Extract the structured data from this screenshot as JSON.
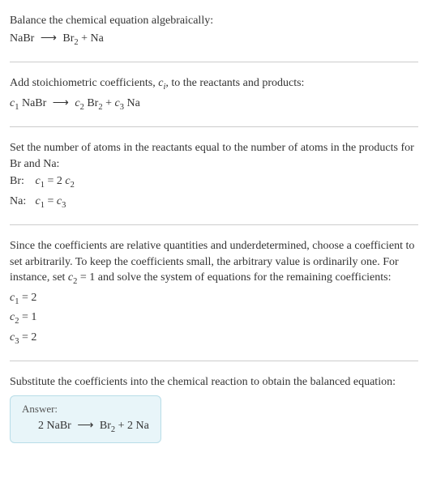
{
  "chart_data": {
    "type": "table",
    "title": "Balance the chemical equation algebraically",
    "equation_unbalanced": "NaBr -> Br2 + Na",
    "equation_with_coeffs": "c1 NaBr -> c2 Br2 + c3 Na",
    "atom_balance": [
      {
        "element": "Br",
        "equation": "c1 = 2 c2"
      },
      {
        "element": "Na",
        "equation": "c1 = c3"
      }
    ],
    "coefficient_solution": [
      {
        "name": "c1",
        "value": 2
      },
      {
        "name": "c2",
        "value": 1
      },
      {
        "name": "c3",
        "value": 2
      }
    ],
    "balanced_equation": "2 NaBr -> Br2 + 2 Na"
  },
  "s1": {
    "heading": "Balance the chemical equation algebraically:",
    "eq_lhs": "NaBr",
    "arrow": "⟶",
    "eq_rhs_a": "Br",
    "eq_rhs_a_sub": "2",
    "eq_rhs_plus": " + Na"
  },
  "s2": {
    "heading_a": "Add stoichiometric coefficients, ",
    "heading_ci": "c",
    "heading_ci_sub": "i",
    "heading_b": ", to the reactants and products:",
    "c1": "c",
    "c1_sub": "1",
    "c1_sp": " NaBr ",
    "arrow": "⟶",
    "c2_sp": " ",
    "c2": "c",
    "c2_sub": "2",
    "c2_br": " Br",
    "c2_br_sub": "2",
    "plus": " + ",
    "c3": "c",
    "c3_sub": "3",
    "c3_na": " Na"
  },
  "s3": {
    "heading": "Set the number of atoms in the reactants equal to the number of atoms in the products for Br and Na:",
    "row1_label": " Br: ",
    "row1_c1": "c",
    "row1_c1_sub": "1",
    "row1_eq": " = 2 ",
    "row1_c2": "c",
    "row1_c2_sub": "2",
    "row2_label": "Na: ",
    "row2_c1": "c",
    "row2_c1_sub": "1",
    "row2_eq": " = ",
    "row2_c3": "c",
    "row2_c3_sub": "3"
  },
  "s4": {
    "heading_a": "Since the coefficients are relative quantities and underdetermined, choose a coefficient to set arbitrarily. To keep the coefficients small, the arbitrary value is ordinarily one. For instance, set ",
    "heading_c2": "c",
    "heading_c2_sub": "2",
    "heading_b": " = 1 and solve the system of equations for the remaining coefficients:",
    "r1_c": "c",
    "r1_sub": "1",
    "r1_val": " = 2",
    "r2_c": "c",
    "r2_sub": "2",
    "r2_val": " = 1",
    "r3_c": "c",
    "r3_sub": "3",
    "r3_val": " = 2"
  },
  "s5": {
    "heading": "Substitute the coefficients into the chemical reaction to obtain the balanced equation:",
    "answer_label": "Answer:",
    "eq_lhs": "2 NaBr ",
    "arrow": "⟶",
    "eq_rhs_a": " Br",
    "eq_rhs_a_sub": "2",
    "eq_rhs_b": " + 2 Na"
  }
}
